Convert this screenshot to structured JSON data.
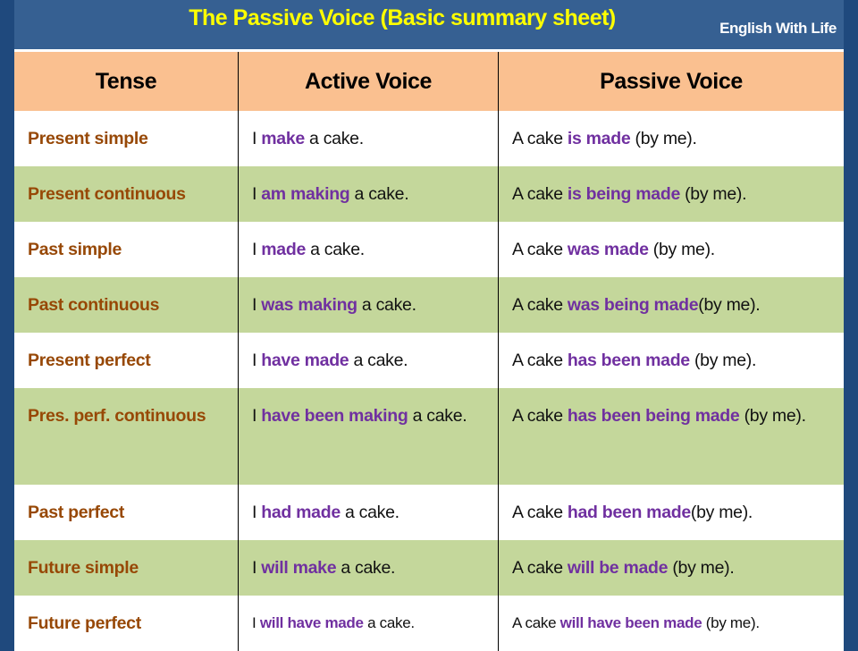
{
  "header": {
    "title": "The Passive Voice (Basic summary sheet)",
    "brand": "English With Life"
  },
  "colors": {
    "background": "#1f497d",
    "title_bar": "#366092",
    "title_text": "#ffff00",
    "header_row": "#fac090",
    "alt_row": "#c4d79b",
    "tense_text": "#974806",
    "highlight": "#7030a0"
  },
  "table": {
    "columns": [
      "Tense",
      "Active Voice",
      "Passive Voice"
    ],
    "rows": [
      {
        "tense": "Present simple",
        "active": {
          "pre": "I ",
          "verb": "make",
          "post": " a cake."
        },
        "passive": {
          "pre": "A cake ",
          "verb": "is made",
          "post": " (by me)."
        }
      },
      {
        "tense": "Present continuous",
        "active": {
          "pre": "I ",
          "verb": "am making",
          "post": " a cake."
        },
        "passive": {
          "pre": "A cake ",
          "verb": "is being made",
          "post": " (by me)."
        }
      },
      {
        "tense": "Past simple",
        "active": {
          "pre": "I ",
          "verb": "made",
          "post": " a cake."
        },
        "passive": {
          "pre": "A cake ",
          "verb": "was made",
          "post": " (by me)."
        }
      },
      {
        "tense": "Past continuous",
        "active": {
          "pre": "I ",
          "verb": "was making",
          "post": " a cake."
        },
        "passive": {
          "pre": "A cake ",
          "verb": "was being made",
          "post": "(by me)."
        }
      },
      {
        "tense": "Present perfect",
        "active": {
          "pre": "I ",
          "verb": "have made",
          "post": " a cake."
        },
        "passive": {
          "pre": "A cake ",
          "verb": "has been made",
          "post": " (by me)."
        }
      },
      {
        "tense": "Pres. perf. continuous",
        "active": {
          "pre": "I ",
          "verb": "have been making",
          "post": " a cake."
        },
        "passive": {
          "pre": "A cake ",
          "verb": "has been being made",
          "post": " (by me)."
        }
      },
      {
        "tense": "Past perfect",
        "active": {
          "pre": "I ",
          "verb": "had made",
          "post": " a cake."
        },
        "passive": {
          "pre": "A cake ",
          "verb": "had been made",
          "post": "(by me)."
        }
      },
      {
        "tense": "Future simple",
        "active": {
          "pre": "I ",
          "verb": "will make",
          "post": " a cake."
        },
        "passive": {
          "pre": "A cake ",
          "verb": "will be made",
          "post": " (by me)."
        }
      },
      {
        "tense": "Future perfect",
        "active": {
          "pre": "I ",
          "verb": "will have made",
          "post": " a cake."
        },
        "passive": {
          "pre": "A cake ",
          "verb": "will have been made",
          "post": " (by me)."
        }
      }
    ]
  }
}
